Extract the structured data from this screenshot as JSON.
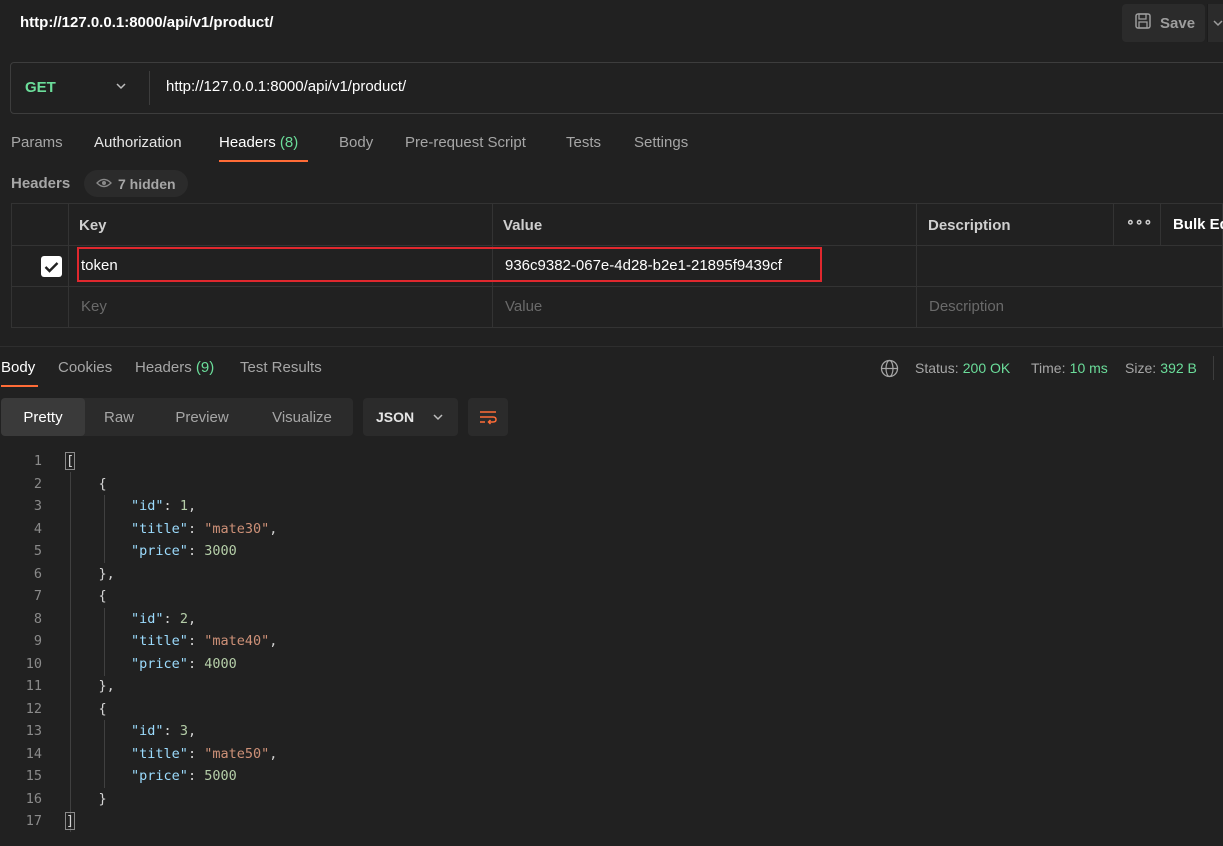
{
  "request": {
    "title": "http://127.0.0.1:8000/api/v1/product/",
    "save_label": "Save",
    "method": "GET",
    "url": "http://127.0.0.1:8000/api/v1/product/"
  },
  "request_tabs": [
    {
      "label": "Params"
    },
    {
      "label": "Authorization"
    },
    {
      "label": "Headers",
      "count": "(8)"
    },
    {
      "label": "Body"
    },
    {
      "label": "Pre-request Script"
    },
    {
      "label": "Tests"
    },
    {
      "label": "Settings"
    }
  ],
  "headers_section": {
    "label": "Headers",
    "hidden_label": "7 hidden",
    "columns": [
      "Key",
      "Value",
      "Description"
    ],
    "more_label": "∘∘∘",
    "bulk_edit_label": "Bulk Edit",
    "rows": [
      {
        "key": "token",
        "value": "936c9382-067e-4d28-b2e1-21895f9439cf",
        "description": "",
        "checked": true
      }
    ],
    "placeholders": {
      "key": "Key",
      "value": "Value",
      "description": "Description"
    }
  },
  "response_tabs": [
    {
      "label": "Body"
    },
    {
      "label": "Cookies"
    },
    {
      "label": "Headers",
      "count": "(9)"
    },
    {
      "label": "Test Results"
    }
  ],
  "status": {
    "status_label": "Status:",
    "status_value": "200 OK",
    "time_label": "Time:",
    "time_value": "10 ms",
    "size_label": "Size:",
    "size_value": "392 B"
  },
  "view_tabs": [
    "Pretty",
    "Raw",
    "Preview",
    "Visualize"
  ],
  "format": "JSON",
  "code_lines": [
    "1",
    "2",
    "3",
    "4",
    "5",
    "6",
    "7",
    "8",
    "9",
    "10",
    "11",
    "12",
    "13",
    "14",
    "15",
    "16",
    "17"
  ],
  "products": [
    {
      "id": "1",
      "title": "\"mate30\"",
      "price": "3000"
    },
    {
      "id": "2",
      "title": "\"mate40\"",
      "price": "4000"
    },
    {
      "id": "3",
      "title": "\"mate50\"",
      "price": "5000"
    }
  ],
  "json_keys": {
    "id": "\"id\"",
    "title": "\"title\"",
    "price": "\"price\""
  },
  "colors": {
    "accent": "#ff6c37",
    "success": "#6bdd9a",
    "highlight": "#e0282e"
  }
}
